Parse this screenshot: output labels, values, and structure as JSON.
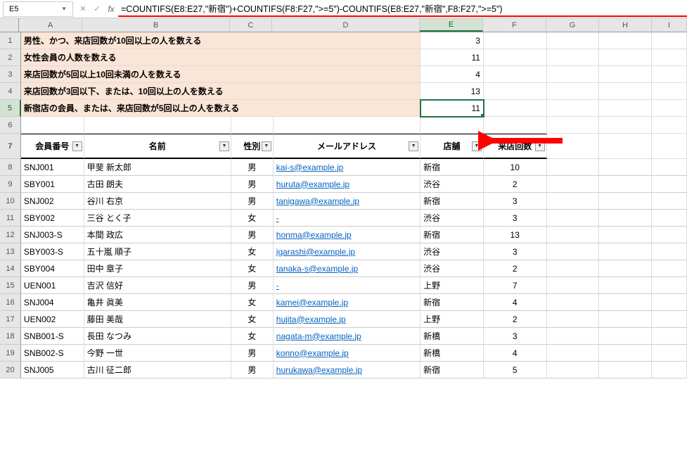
{
  "nameBox": "E5",
  "formula": "=COUNTIFS(E8:E27,\"新宿\")+COUNTIFS(F8:F27,\">=5\")-COUNTIFS(E8:E27,\"新宿\",F8:F27,\">=5\")",
  "columns": [
    "A",
    "B",
    "C",
    "D",
    "E",
    "F",
    "G",
    "H",
    "I"
  ],
  "colWidths": [
    "wA",
    "wB",
    "wC",
    "wD",
    "wE",
    "wF",
    "wG",
    "wH",
    "wI"
  ],
  "summary": [
    {
      "row": 1,
      "label": "男性、かつ、来店回数が10回以上の人を数える",
      "value": "3"
    },
    {
      "row": 2,
      "label": "女性会員の人数を数える",
      "value": "11"
    },
    {
      "row": 3,
      "label": "来店回数が5回以上10回未満の人を数える",
      "value": "4"
    },
    {
      "row": 4,
      "label": "来店回数が3回以下、または、10回以上の人を数える",
      "value": "13"
    },
    {
      "row": 5,
      "label": "新宿店の会員、または、来店回数が5回以上の人を数える",
      "value": "11"
    }
  ],
  "headers": {
    "id": "会員番号",
    "name": "名前",
    "gender": "性別",
    "email": "メールアドレス",
    "store": "店舗",
    "visits": "来店回数"
  },
  "members": [
    {
      "row": 8,
      "id": "SNJ001",
      "name": "甲斐 新太郎",
      "gender": "男",
      "email": "kai-s@example.jp",
      "store": "新宿",
      "visits": "10"
    },
    {
      "row": 9,
      "id": "SBY001",
      "name": "古田 朗夫",
      "gender": "男",
      "email": "huruta@example.jp",
      "store": "渋谷",
      "visits": "2"
    },
    {
      "row": 10,
      "id": "SNJ002",
      "name": "谷川 右京",
      "gender": "男",
      "email": "tanigawa@example.jp",
      "store": "新宿",
      "visits": "3"
    },
    {
      "row": 11,
      "id": "SBY002",
      "name": "三谷 とく子",
      "gender": "女",
      "email": "-",
      "store": "渋谷",
      "visits": "3"
    },
    {
      "row": 12,
      "id": "SNJ003-S",
      "name": "本間 政広",
      "gender": "男",
      "email": "honma@example.jp",
      "store": "新宿",
      "visits": "13"
    },
    {
      "row": 13,
      "id": "SBY003-S",
      "name": "五十嵐 順子",
      "gender": "女",
      "email": "igarashi@example.jp",
      "store": "渋谷",
      "visits": "3"
    },
    {
      "row": 14,
      "id": "SBY004",
      "name": "田中 章子",
      "gender": "女",
      "email": "tanaka-s@example.jp",
      "store": "渋谷",
      "visits": "2"
    },
    {
      "row": 15,
      "id": "UEN001",
      "name": "吉沢 信好",
      "gender": "男",
      "email": "-",
      "store": "上野",
      "visits": "7"
    },
    {
      "row": 16,
      "id": "SNJ004",
      "name": "亀井 眞美",
      "gender": "女",
      "email": "kamei@example.jp",
      "store": "新宿",
      "visits": "4"
    },
    {
      "row": 17,
      "id": "UEN002",
      "name": "藤田 美哉",
      "gender": "女",
      "email": "hujita@example.jp",
      "store": "上野",
      "visits": "2"
    },
    {
      "row": 18,
      "id": "SNB001-S",
      "name": "長田 なつみ",
      "gender": "女",
      "email": "nagata-m@example.jp",
      "store": "新橋",
      "visits": "3"
    },
    {
      "row": 19,
      "id": "SNB002-S",
      "name": "今野 一世",
      "gender": "男",
      "email": "konno@example.jp",
      "store": "新橋",
      "visits": "4"
    },
    {
      "row": 20,
      "id": "SNJ005",
      "name": "古川 征二郎",
      "gender": "男",
      "email": "hurukawa@example.jp",
      "store": "新宿",
      "visits": "5"
    }
  ]
}
